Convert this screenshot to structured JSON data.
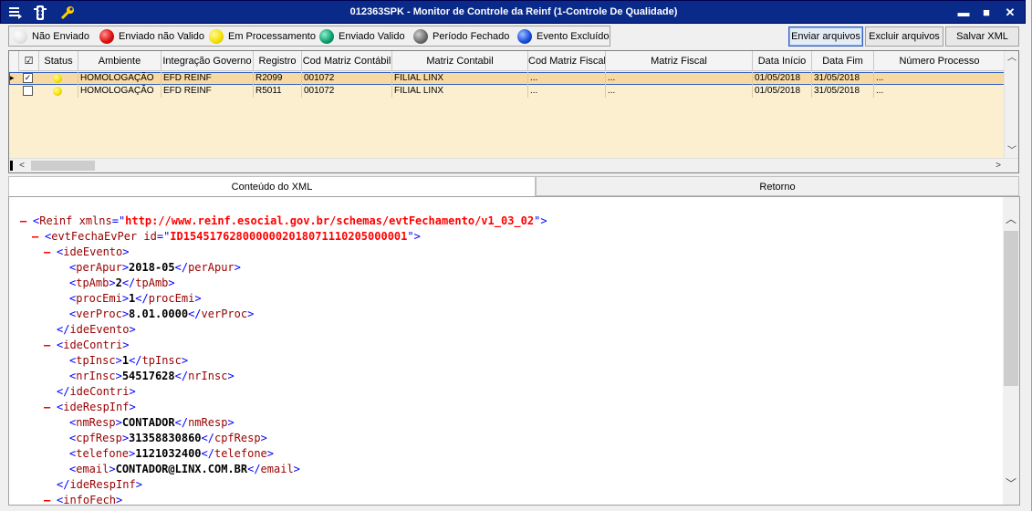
{
  "titlebar": {
    "title": "012363SPK - Monitor de Controle da Reinf (1-Controle De Qualidade)",
    "icons": [
      "menu-icon",
      "traffic-light-icon",
      "wrench-icon"
    ],
    "minimize": "▬",
    "maximize": "■",
    "close": "✕"
  },
  "legend": [
    {
      "label": "Não Enviado",
      "color": "#f4f4f4",
      "icon": "white-ball-icon"
    },
    {
      "label": "Enviado não Valido",
      "color": "#e01010",
      "icon": "red-ball-icon"
    },
    {
      "label": "Em Processamento",
      "color": "#f5e300",
      "icon": "yellow-ball-icon"
    },
    {
      "label": "Enviado Valido",
      "color": "#10a070",
      "icon": "green-ball-icon"
    },
    {
      "label": "Período Fechado",
      "color": "#707070",
      "icon": "gray-ball-icon"
    },
    {
      "label": "Evento Excluído",
      "color": "#1a50e0",
      "icon": "blue-ball-icon"
    }
  ],
  "actions": {
    "send": "Enviar arquivos",
    "delete": "Excluir arquivos",
    "save": "Salvar XML"
  },
  "grid": {
    "headers": {
      "check": "☑",
      "status": "Status",
      "ambiente": "Ambiente",
      "integracao": "Integração Governo",
      "registro": "Registro",
      "cod_matriz_contabil": "Cod Matriz Contábil",
      "matriz_contabil": "Matriz Contabil",
      "cod_matriz_fiscal": "Cod Matriz Fiscal",
      "matriz_fiscal": "Matriz Fiscal",
      "data_inicio": "Data Início",
      "data_fim": "Data Fim",
      "numero_processo": "Número Processo"
    },
    "rows": [
      {
        "checked": "✓",
        "ambiente": "HOMOLOGAÇÃO",
        "integracao": "EFD REINF",
        "registro": "R2099",
        "cod_matriz_contabil": "001072",
        "matriz_contabil": "FILIAL LINX",
        "cod_matriz_fiscal": "...",
        "matriz_fiscal": "...",
        "data_inicio": "01/05/2018",
        "data_fim": "31/05/2018",
        "numero_processo": "..."
      },
      {
        "checked": "",
        "ambiente": "HOMOLOGAÇÃO",
        "integracao": "EFD REINF",
        "registro": "R5011",
        "cod_matriz_contabil": "001072",
        "matriz_contabil": "FILIAL LINX",
        "cod_matriz_fiscal": "...",
        "matriz_fiscal": "...",
        "data_inicio": "01/05/2018",
        "data_fim": "31/05/2018",
        "numero_processo": "..."
      }
    ],
    "row_indicator": "▸",
    "scroll_up": "︿",
    "scroll_down": "﹀",
    "scroll_left": "<",
    "scroll_right": ">"
  },
  "tabs": {
    "xml": "Conteúdo do XML",
    "retorno": "Retorno"
  },
  "xml": {
    "collapse": "–",
    "reinf_tag": "Reinf",
    "reinf_attr": "xmlns",
    "reinf_value": "http://www.reinf.esocial.gov.br/schemas/evtFechamento/v1_03_02",
    "evt_tag": "evtFechaEvPer",
    "evt_attr": "id",
    "evt_value": "ID1545176280000002018071110205000001",
    "ideEvento": "ideEvento",
    "perApur": "perApur",
    "perApur_v": "2018-05",
    "tpAmb": "tpAmb",
    "tpAmb_v": "2",
    "procEmi": "procEmi",
    "procEmi_v": "1",
    "verProc": "verProc",
    "verProc_v": "8.01.0000",
    "ideContri": "ideContri",
    "tpInsc": "tpInsc",
    "tpInsc_v": "1",
    "nrInsc": "nrInsc",
    "nrInsc_v": "54517628",
    "ideRespInf": "ideRespInf",
    "nmResp": "nmResp",
    "nmResp_v": "CONTADOR",
    "cpfResp": "cpfResp",
    "cpfResp_v": "31358830860",
    "telefone": "telefone",
    "telefone_v": "1121032400",
    "email": "email",
    "email_v": "CONTADOR@LINX.COM.BR",
    "infoFech": "infoFech",
    "scroll_up": "︿",
    "scroll_down": "﹀"
  }
}
